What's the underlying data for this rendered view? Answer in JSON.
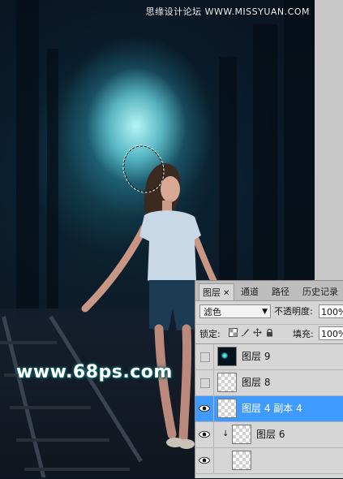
{
  "watermarks": {
    "brand": "思缘设计论坛 WWW.MISSYUAN.COM",
    "site": "www.68ps.com"
  },
  "layers_panel": {
    "tabs": [
      {
        "label": "图层",
        "active": true,
        "closable": true
      },
      {
        "label": "通道",
        "active": false
      },
      {
        "label": "路径",
        "active": false
      },
      {
        "label": "历史记录",
        "active": false
      }
    ],
    "blend_mode": "滤色",
    "opacity_label": "不透明度:",
    "opacity_value": "100%",
    "lock_label": "锁定:",
    "lock_icons": [
      "transparency-lock-icon",
      "brush-lock-icon",
      "move-lock-icon",
      "padlock-icon"
    ],
    "fill_label": "填充:",
    "fill_value": "100%",
    "layers": [
      {
        "name": "图层 9",
        "visible": false,
        "selected": false,
        "thumbnail": "dark-glow"
      },
      {
        "name": "图层 8",
        "visible": false,
        "selected": false,
        "thumbnail": "transparent"
      },
      {
        "name": "图层 4 副本 4",
        "visible": true,
        "selected": true,
        "thumbnail": "transparent"
      },
      {
        "name": "图层 6",
        "visible": true,
        "selected": false,
        "clipped": true,
        "thumbnail": "transparent"
      },
      {
        "name": "",
        "visible": true,
        "selected": false,
        "thumbnail": "transparent"
      }
    ]
  },
  "colors": {
    "selection_blue": "#3f9bff",
    "panel_gray": "#d6d6d6",
    "glow_cyan": "#8ff"
  }
}
